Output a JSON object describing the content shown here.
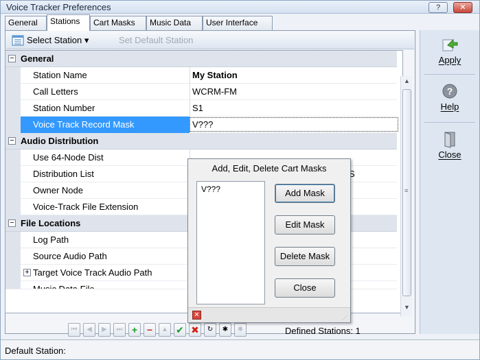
{
  "window": {
    "title": "Voice Tracker Preferences",
    "help_btn": "?",
    "close_btn": "✕"
  },
  "tabs": [
    {
      "label": "General"
    },
    {
      "label": "Stations"
    },
    {
      "label": "Cart Masks"
    },
    {
      "label": "Music Data"
    },
    {
      "label": "User Interface"
    }
  ],
  "toolbar": {
    "select_station": "Select Station ▾",
    "set_default": "Set Default Station"
  },
  "grid": {
    "categories": [
      {
        "label": "General",
        "expander": "−"
      },
      {
        "label": "Audio Distribution",
        "expander": "−"
      },
      {
        "label": "File Locations",
        "expander": "−"
      }
    ],
    "rows": [
      {
        "label": "Station Name",
        "value": "My Station"
      },
      {
        "label": "Call Letters",
        "value": "WCRM-FM"
      },
      {
        "label": "Station Number",
        "value": "S1"
      },
      {
        "label": "Voice Track Record Mask",
        "value": "V???"
      },
      {
        "label": "Use 64-Node Dist",
        "value": ""
      },
      {
        "label": "Distribution List",
        "value": "S"
      },
      {
        "label": "Owner Node",
        "value": ""
      },
      {
        "label": "Voice-Track File Extension",
        "value": ""
      },
      {
        "label": "Log Path",
        "value": ""
      },
      {
        "label": "Source Audio Path",
        "value": ""
      },
      {
        "label": "Target Voice Track Audio Path",
        "value": "",
        "expander": "+"
      },
      {
        "label": "Music Data File",
        "value": ""
      }
    ]
  },
  "popup": {
    "title": "Add, Edit, Delete Cart Masks",
    "masks": [
      "V???"
    ],
    "add": "Add Mask",
    "edit": "Edit Mask",
    "delete": "Delete Mask",
    "close": "Close"
  },
  "navigator": {
    "defined_stations": "Defined Stations: 1"
  },
  "sidebar": {
    "apply": "Apply",
    "help": "Help",
    "close": "Close"
  },
  "status": {
    "text": "Default Station:"
  }
}
